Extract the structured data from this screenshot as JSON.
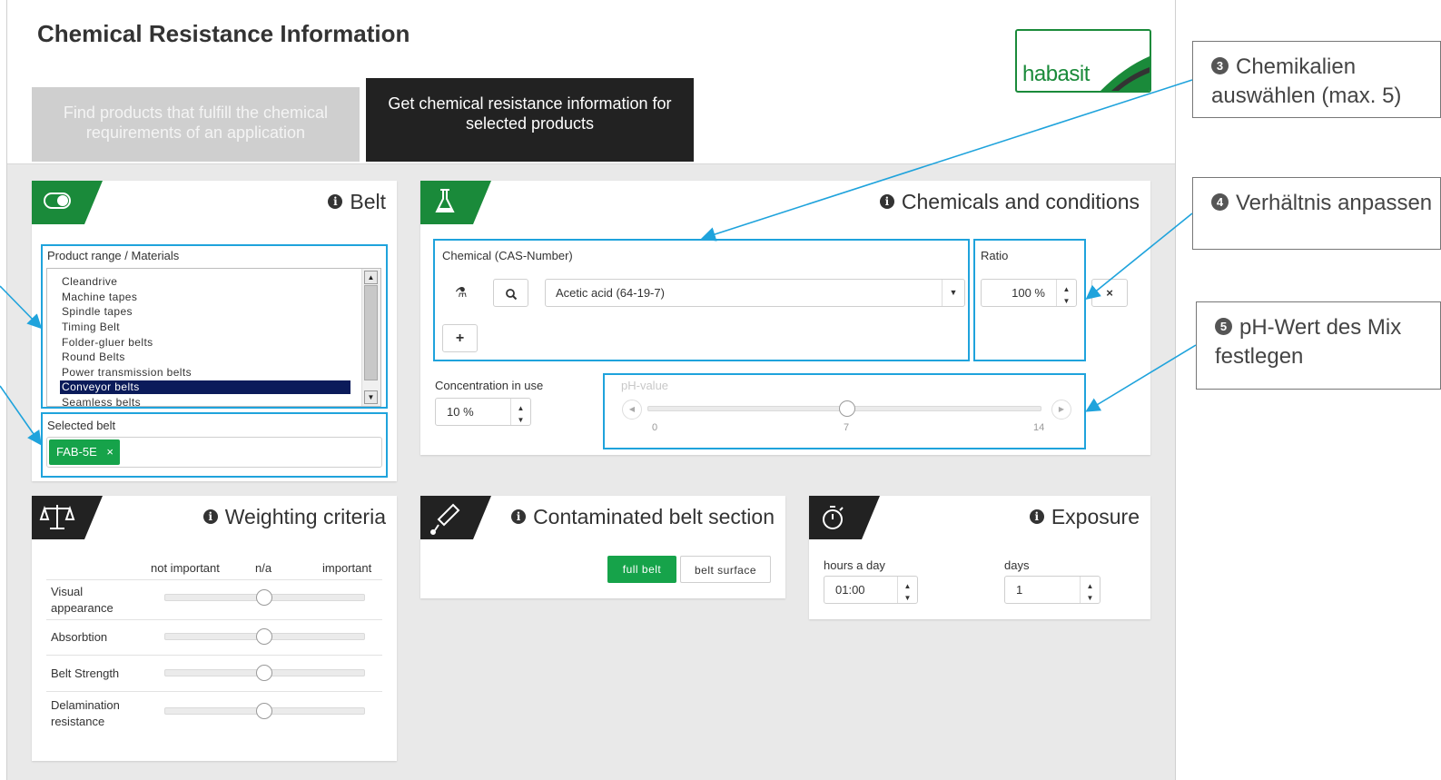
{
  "header": {
    "title": "Chemical Resistance Information",
    "logo_text": "habasit",
    "tabs": [
      {
        "label": "Find products that fulfill the chemical requirements of an application",
        "active": false
      },
      {
        "label": "Get chemical resistance information for selected products",
        "active": true
      }
    ]
  },
  "belt": {
    "title": "Belt",
    "product_range_label": "Product range / Materials",
    "items": [
      "Cleandrive",
      "Machine tapes",
      "Spindle tapes",
      "Timing Belt",
      "Folder-gluer belts",
      "Round Belts",
      "Power transmission belts",
      "Conveyor belts",
      "Seamless belts"
    ],
    "selected_item": "Conveyor belts",
    "selected_belt_label": "Selected belt",
    "selected_belt_chip": "FAB-5E",
    "chip_remove": "×"
  },
  "chemicals": {
    "title": "Chemicals and conditions",
    "chemical_label": "Chemical (CAS-Number)",
    "chemical_value": "Acetic acid (64-19-7)",
    "ratio_label": "Ratio",
    "ratio_value": "100 %",
    "remove_symbol": "×",
    "add_symbol": "+",
    "concentration_label": "Concentration in use",
    "concentration_value": "10 %",
    "ph_label": "pH-value",
    "ph_value": 7,
    "ph_ticks": [
      "0",
      "7",
      "14"
    ]
  },
  "weighting": {
    "title": "Weighting criteria",
    "scale_labels": [
      "not important",
      "n/a",
      "important"
    ],
    "criteria": [
      {
        "label": "Visual appearance",
        "value": 0.5
      },
      {
        "label": "Absorbtion",
        "value": 0.5
      },
      {
        "label": "Belt Strength",
        "value": 0.5
      },
      {
        "label": "Delamination resistance",
        "value": 0.5
      }
    ]
  },
  "contaminated": {
    "title": "Contaminated belt section",
    "options": [
      "full belt",
      "belt surface"
    ],
    "selected": "full belt"
  },
  "exposure": {
    "title": "Exposure",
    "hours_label": "hours a day",
    "hours_value": "01:00",
    "days_label": "days",
    "days_value": "1"
  },
  "callouts": [
    {
      "num": "3",
      "text": "Chemikalien auswählen (max. 5)"
    },
    {
      "num": "4",
      "text": "Verhältnis anpassen"
    },
    {
      "num": "5",
      "text": "pH-Wert des Mix festlegen"
    }
  ],
  "colors": {
    "accent": "#1a8a3a",
    "callout_line": "#1fa3dc",
    "dark": "#222222",
    "selection": "#0b1b5a"
  }
}
